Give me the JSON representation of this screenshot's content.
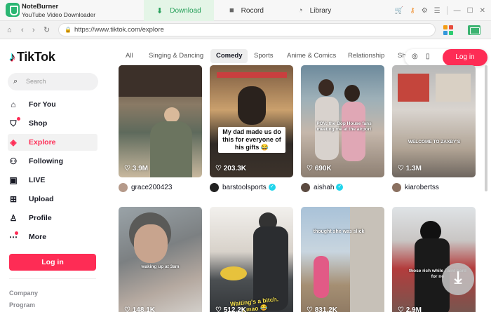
{
  "app": {
    "name": "NoteBurner",
    "subtitle": "YouTube Video Downloader",
    "tabs": [
      {
        "label": "Download",
        "icon": "download-icon",
        "active": true
      },
      {
        "label": "Rocord",
        "icon": "video-camera-icon",
        "active": false
      },
      {
        "label": "Library",
        "icon": "clock-icon",
        "active": false
      }
    ],
    "accent_color": "#27a05a"
  },
  "browser": {
    "url": "https://www.tiktok.com/explore"
  },
  "sidebar": {
    "brand": "TikTok",
    "search_placeholder": "Search",
    "items": [
      {
        "label": "For You",
        "icon": "home-icon"
      },
      {
        "label": "Shop",
        "icon": "shopping-bag-icon"
      },
      {
        "label": "Explore",
        "icon": "compass-icon",
        "active": true
      },
      {
        "label": "Following",
        "icon": "following-icon"
      },
      {
        "label": "LIVE",
        "icon": "live-icon"
      },
      {
        "label": "Upload",
        "icon": "plus-square-icon"
      },
      {
        "label": "Profile",
        "icon": "profile-icon"
      },
      {
        "label": "More",
        "icon": "more-icon"
      }
    ],
    "login_label": "Log in",
    "footer": [
      "Company",
      "Program"
    ],
    "brand_color": "#fe2c55"
  },
  "categories": [
    "All",
    "Singing & Dancing",
    "Comedy",
    "Sports",
    "Anime & Comics",
    "Relationship",
    "Sho"
  ],
  "active_category": "Comedy",
  "top_login": "Log in",
  "videos": [
    {
      "likes": "3.9M",
      "user": "grace200423",
      "verified": false,
      "overlay": ""
    },
    {
      "likes": "203.3K",
      "user": "barstoolsports",
      "verified": true,
      "overlay": "My dad made us do this for everyone of his gifts 😂"
    },
    {
      "likes": "690K",
      "user": "aishah",
      "verified": true,
      "overlay": ""
    },
    {
      "likes": "1.3M",
      "user": "kiarobertss",
      "verified": false,
      "overlay": ""
    },
    {
      "likes": "148.1K",
      "user": "",
      "verified": false,
      "overlay": ""
    },
    {
      "likes": "512.2K",
      "user": "",
      "verified": false,
      "overlay": ""
    },
    {
      "likes": "831.2K",
      "user": "",
      "verified": false,
      "overlay": ""
    },
    {
      "likes": "2.9M",
      "user": "",
      "verified": false,
      "overlay": ""
    }
  ],
  "video_captions": {
    "v3": "POV: the Bop House fans meeting me at the airport",
    "v4": "WELCOME TO ZAXBY'S",
    "v5": "waking up at 3am",
    "v6": "Waiting's a bitch. Lmao 😂",
    "v7": "thought she was slick",
    "v8": "those rich while i aint hard for no"
  }
}
